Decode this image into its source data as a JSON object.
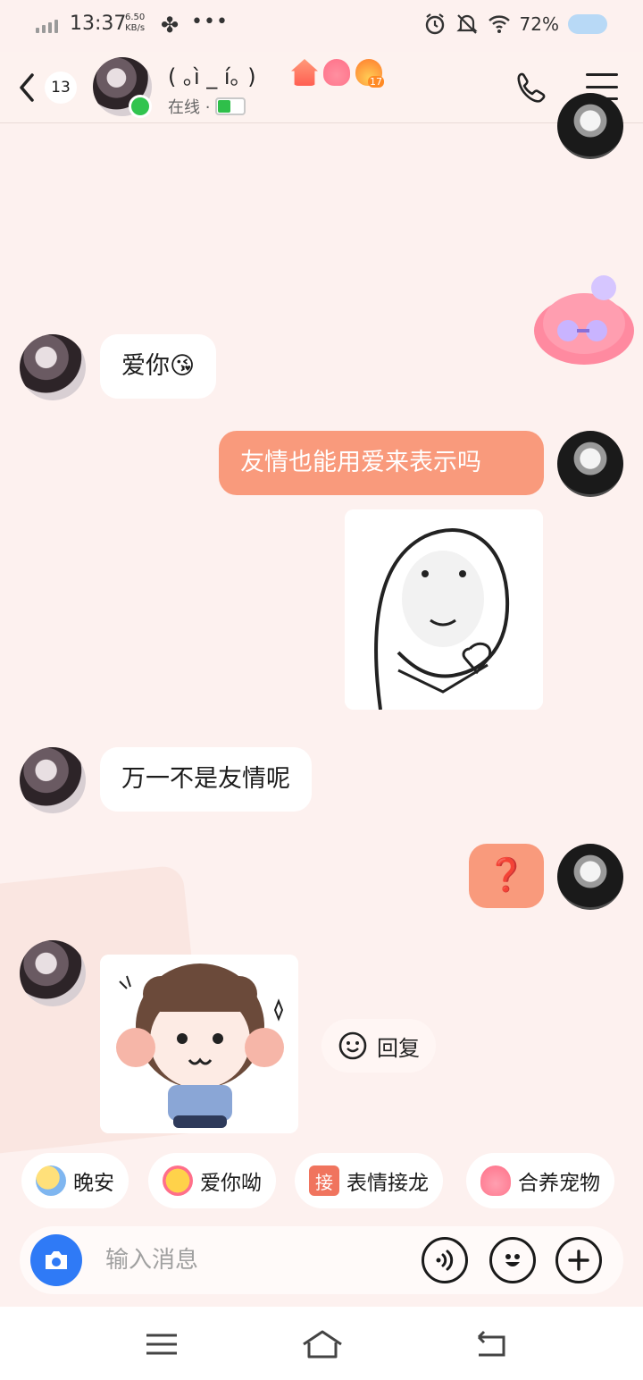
{
  "status_bar": {
    "time": "13:37",
    "speed_value": "6.50",
    "speed_unit": "KB/s",
    "battery": "72%",
    "dots": "•••"
  },
  "header": {
    "unread_count": "13",
    "contact_name": "( ｡ì _ í｡ )",
    "status_text": "在线 ·",
    "fire_level": "17",
    "accent_online": "#31c44f"
  },
  "messages": [
    {
      "from": "other",
      "type": "text",
      "text": "爱你😘"
    },
    {
      "from": "self",
      "type": "text",
      "text": "友情也能用爱来表示吗"
    },
    {
      "from": "self",
      "type": "sticker",
      "desc": "meme-face-heart-sticker"
    },
    {
      "from": "other",
      "type": "text",
      "text": "万一不是友情呢"
    },
    {
      "from": "self",
      "type": "text",
      "text": "❓"
    },
    {
      "from": "other",
      "type": "sticker",
      "desc": "girl-police-sticker"
    }
  ],
  "reply_label": "回复",
  "quick_actions": [
    {
      "label": "晚安",
      "icon": "moon-face-icon"
    },
    {
      "label": "爱你呦",
      "icon": "heart-face-icon"
    },
    {
      "label": "表情接龙",
      "icon": "jie-badge-icon",
      "glyph": "接"
    },
    {
      "label": "合养宠物",
      "icon": "pet-blob-icon"
    }
  ],
  "input": {
    "placeholder": "输入消息"
  },
  "colors": {
    "bubble_out": "#f99a7c",
    "bubble_in": "#ffffff",
    "camera": "#2f7af6",
    "background": "#fdf1ef"
  }
}
